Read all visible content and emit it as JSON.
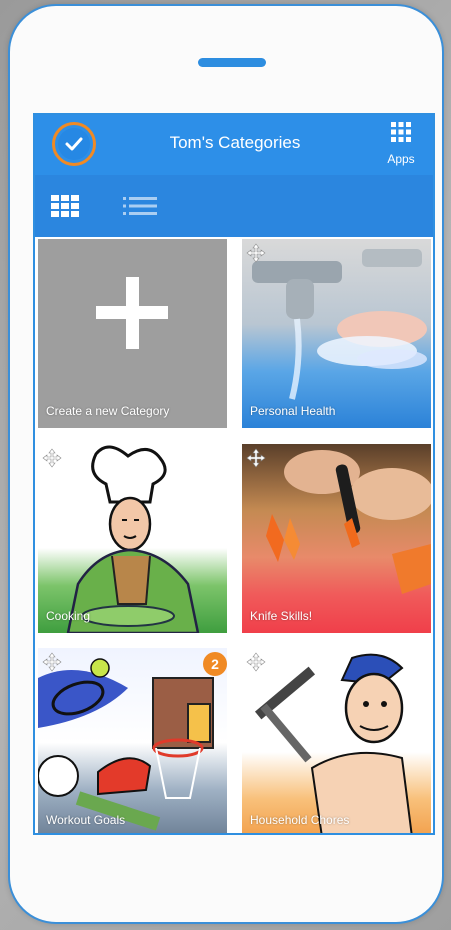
{
  "header": {
    "title": "Tom's Categories",
    "apps_label": "Apps"
  },
  "icons": {
    "logo": "check-circle-icon",
    "apps": "apps-grid-icon",
    "grid_view": "grid-view-icon",
    "list_view": "list-view-icon",
    "move": "move-arrows-icon"
  },
  "colors": {
    "primary": "#2d8fe8",
    "accent": "#f08a24",
    "badge": "#f08a24"
  },
  "tiles": [
    {
      "label": "Create a new Category"
    },
    {
      "label": "Personal Health"
    },
    {
      "label": "Cooking"
    },
    {
      "label": "Knife Skills!"
    },
    {
      "label": "Workout Goals",
      "badge": "2"
    },
    {
      "label": "Household Chores"
    }
  ]
}
